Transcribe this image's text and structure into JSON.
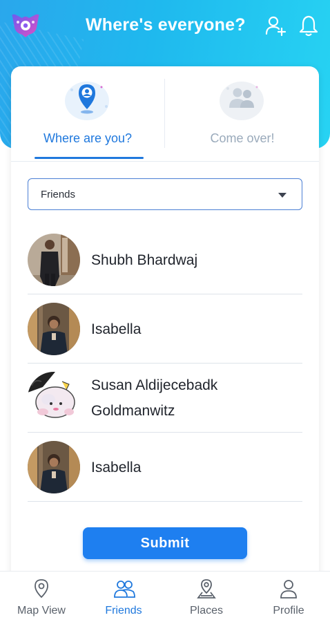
{
  "header": {
    "title": "Where's everyone?",
    "icons": [
      "app-logo",
      "add-user-icon",
      "bell-icon"
    ]
  },
  "tabs": [
    {
      "label": "Where are you?",
      "icon": "location-pin-icon",
      "active": true
    },
    {
      "label": "Come over!",
      "icon": "group-icon",
      "active": false
    }
  ],
  "dropdown": {
    "selected": "Friends"
  },
  "friends": [
    {
      "name": "Shubh Bhardwaj"
    },
    {
      "name": "Isabella"
    },
    {
      "name": "Susan Aldijecebadk Goldmanwitz"
    },
    {
      "name": "Isabella"
    }
  ],
  "submit_label": "Submit",
  "nav": [
    {
      "label": "Map View",
      "icon": "map-pin-icon",
      "active": false
    },
    {
      "label": "Friends",
      "icon": "friends-icon",
      "active": true
    },
    {
      "label": "Places",
      "icon": "places-icon",
      "active": false
    },
    {
      "label": "Profile",
      "icon": "profile-icon",
      "active": false
    }
  ],
  "colors": {
    "primary": "#1f78dd",
    "button": "#1e7ff0",
    "header_gradient_start": "#2aa7ec",
    "header_gradient_end": "#27d3f3",
    "inactive_tab": "#9aaabb"
  }
}
